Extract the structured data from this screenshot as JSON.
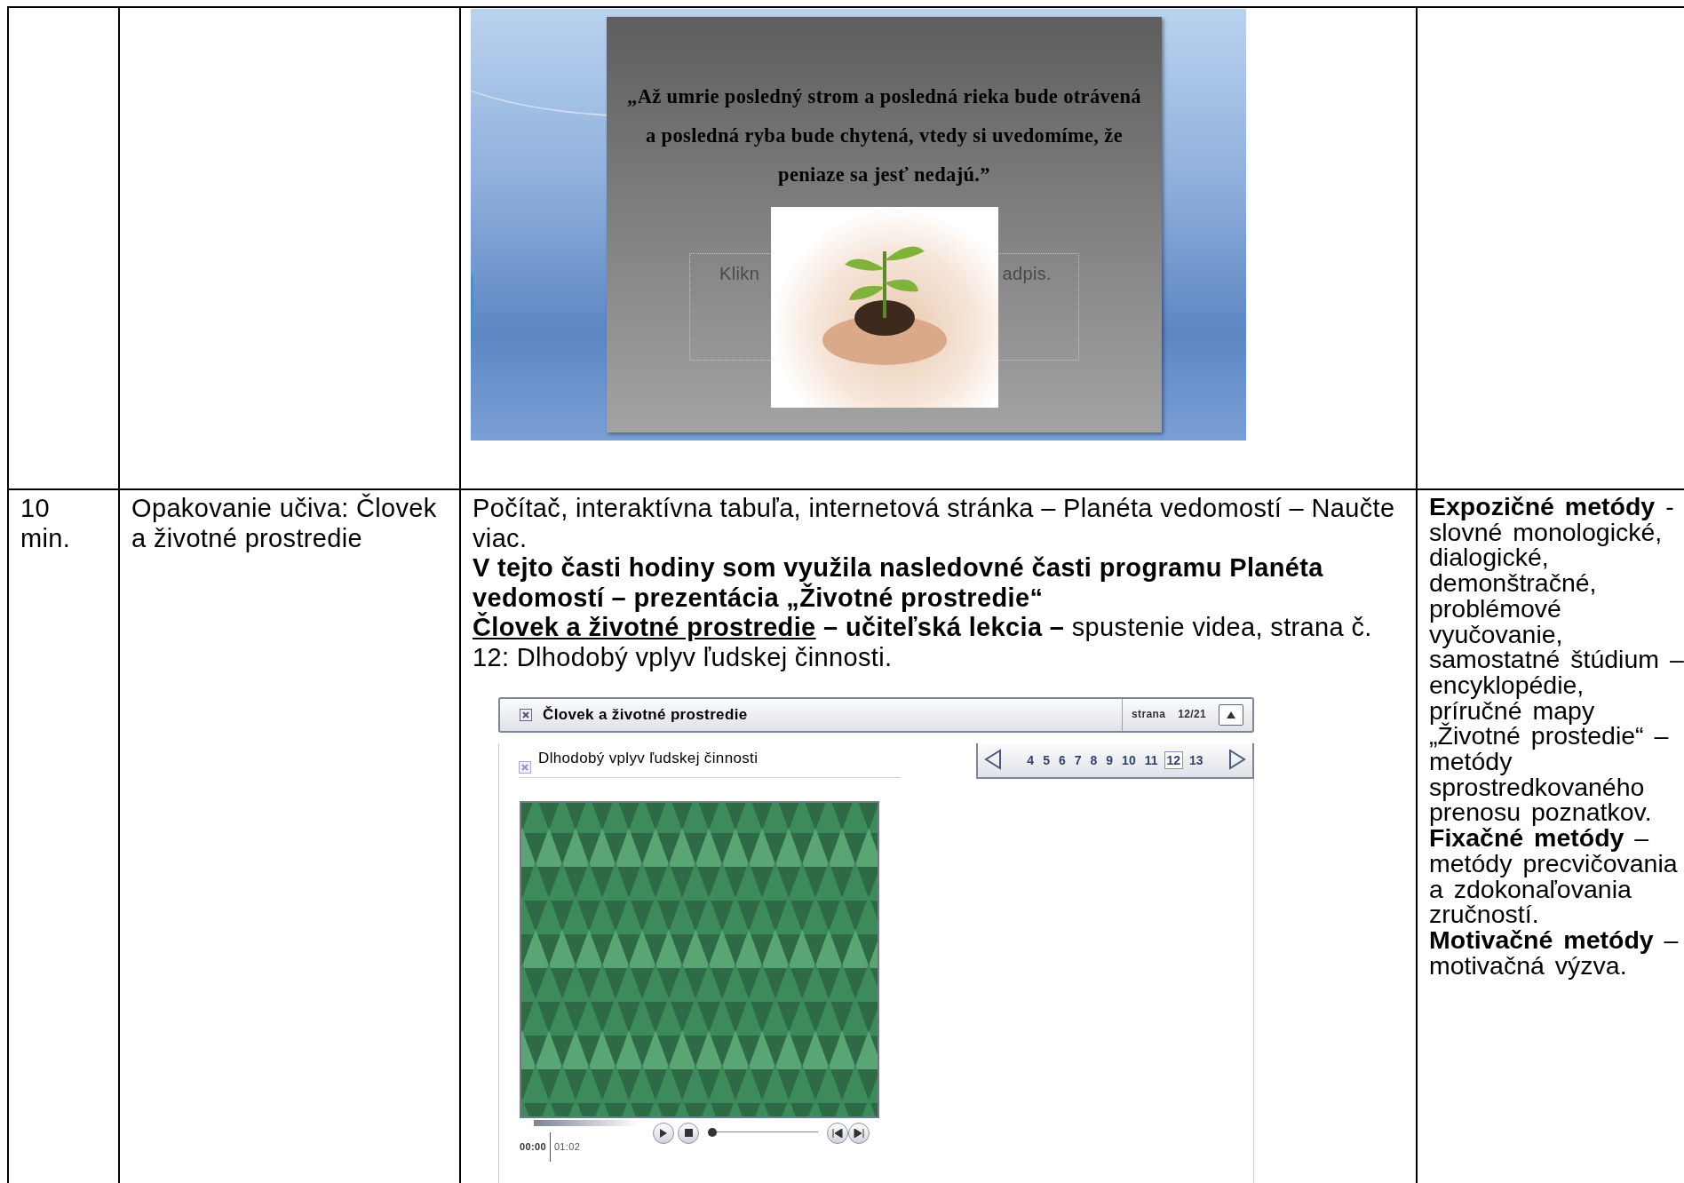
{
  "table": {
    "rows": [
      {
        "kind": "slide",
        "slide": {
          "quote_lines": [
            "„Až umrie posledný strom a posledná rieka  bude otrávená",
            "a posledná ryba  bude chytená, vtedy si uvedomíme, že",
            "peniaze sa jesť nedajú.”"
          ],
          "placeholder_fragments": [
            "Klikn",
            "adpis."
          ]
        }
      },
      {
        "kind": "lesson",
        "time": "10 min.",
        "topic": "Opakovanie učiva: Človek a životné prostredie",
        "paragraphs": [
          {
            "kind": "plain",
            "text": "Počítač, interaktívna tabuľa, internetová stránka – Planéta vedomostí – Naučte viac."
          },
          {
            "kind": "bold",
            "text": "V tejto časti hodiny som využila nasledovné časti programu Planéta vedomostí – prezentácia „Životné prostredie“"
          },
          {
            "kind": "underlined_lead",
            "lead": "Človek a životné prostredie",
            "text": "**– učiteľská lekcia –** spustenie videa, strana č. 12: Dlhodobý vplyv ľudskej činnosti."
          }
        ],
        "app": {
          "title": "Človek a životné prostredie",
          "page_label": "strana",
          "page": "12/21",
          "pages": [
            {
              "label": "4",
              "selected": false
            },
            {
              "label": "5",
              "selected": false
            },
            {
              "label": "6",
              "selected": false
            },
            {
              "label": "7",
              "selected": false
            },
            {
              "label": "8",
              "selected": false
            },
            {
              "label": "9",
              "selected": false
            },
            {
              "label": "10",
              "selected": false
            },
            {
              "label": "11",
              "selected": false
            },
            {
              "label": "12",
              "selected": true
            },
            {
              "label": "13",
              "selected": false
            }
          ],
          "subtitle": "Dlhodobý vplyv ľudskej činnosti",
          "elapsed": "00:00",
          "total": "01:02",
          "seek": {
            "level": 0
          }
        },
        "methods": [
          "**Expozičné metódy**  - slovné monologické, dialogické, demonštračné, problémové vyučovanie, samostatné štúdium – encyklopédie, príručné mapy „Životné prostedie“ – metódy sprostredkovaného prenosu poznatkov.",
          "**Fixačné metódy** – metódy precvičovania a zdokonaľovania zručností.",
          "**Motivačné metódy** – motivačná výzva."
        ]
      }
    ]
  }
}
